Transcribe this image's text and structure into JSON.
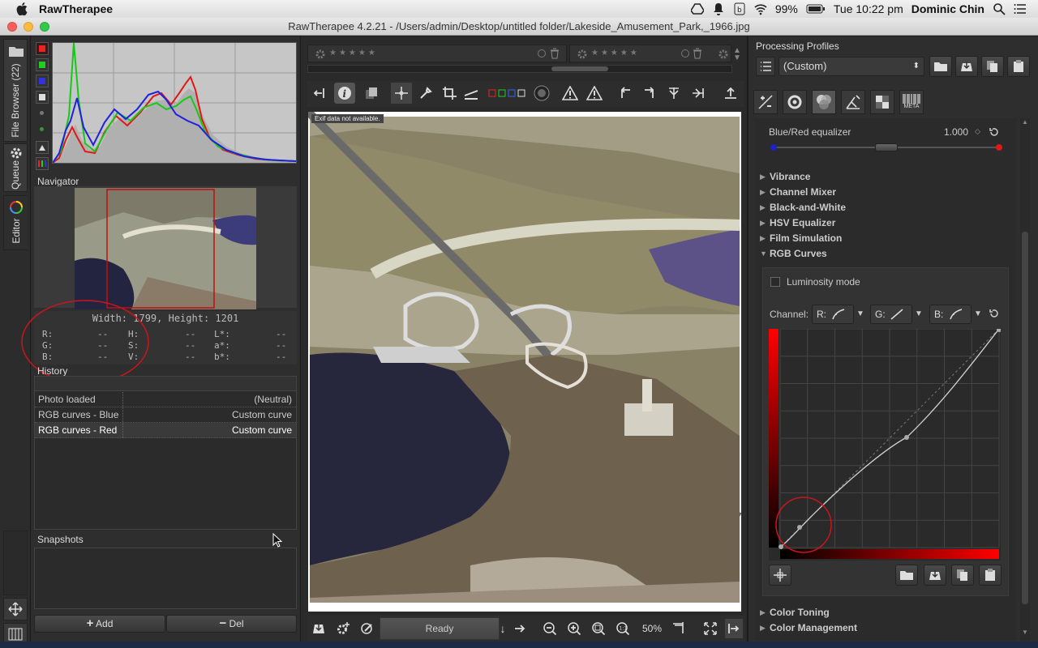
{
  "menubar": {
    "app_name": "RawTherapee",
    "battery": "99%",
    "clock": "Tue 10:22 pm",
    "user": "Dominic Chin"
  },
  "window": {
    "title": "RawTherapee 4.2.21 - /Users/admin/Desktop/untitled folder/Lakeside_Amusement_Park,_1966.jpg"
  },
  "left_tabs": {
    "file_browser": "File Browser (22)",
    "queue": "Queue",
    "editor": "Editor"
  },
  "navigator": {
    "title": "Navigator",
    "size": "Width: 1799, Height: 1201",
    "readouts": [
      {
        "label": "R:",
        "value": "--"
      },
      {
        "label": "G:",
        "value": "--"
      },
      {
        "label": "B:",
        "value": "--"
      },
      {
        "label": "H:",
        "value": "--"
      },
      {
        "label": "S:",
        "value": "--"
      },
      {
        "label": "V:",
        "value": "--"
      },
      {
        "label": "L*:",
        "value": "--"
      },
      {
        "label": "a*:",
        "value": "--"
      },
      {
        "label": "b*:",
        "value": "--"
      }
    ]
  },
  "history": {
    "title": "History",
    "rows": [
      {
        "label": "Photo loaded",
        "value": "(Neutral)"
      },
      {
        "label": "RGB curves - Blue",
        "value": "Custom curve"
      },
      {
        "label": "RGB curves - Red",
        "value": "Custom curve"
      }
    ]
  },
  "snapshots": {
    "title": "Snapshots",
    "add_label": "Add",
    "del_label": "Del"
  },
  "viewer": {
    "exif_note": "Exif data not available.",
    "status": "Ready",
    "zoom": "50%"
  },
  "profiles": {
    "title": "Processing Profiles",
    "selected": "(Custom)",
    "meta_tab": "META"
  },
  "tools": {
    "equalizer_label": "Blue/Red equalizer",
    "equalizer_value": "1.000",
    "equalizer_level": 0.5,
    "sections": [
      "Vibrance",
      "Channel Mixer",
      "Black-and-White",
      "HSV Equalizer",
      "Film Simulation",
      "RGB Curves"
    ],
    "luminosity_mode": "Luminosity mode",
    "channel_label": "Channel:",
    "channel_r": "R:",
    "channel_g": "G:",
    "channel_b": "B:",
    "bottom_sections": [
      "Color Toning",
      "Color Management"
    ]
  },
  "colors": {
    "accent_red": "#d0201f",
    "annotation": "#c8161c"
  }
}
